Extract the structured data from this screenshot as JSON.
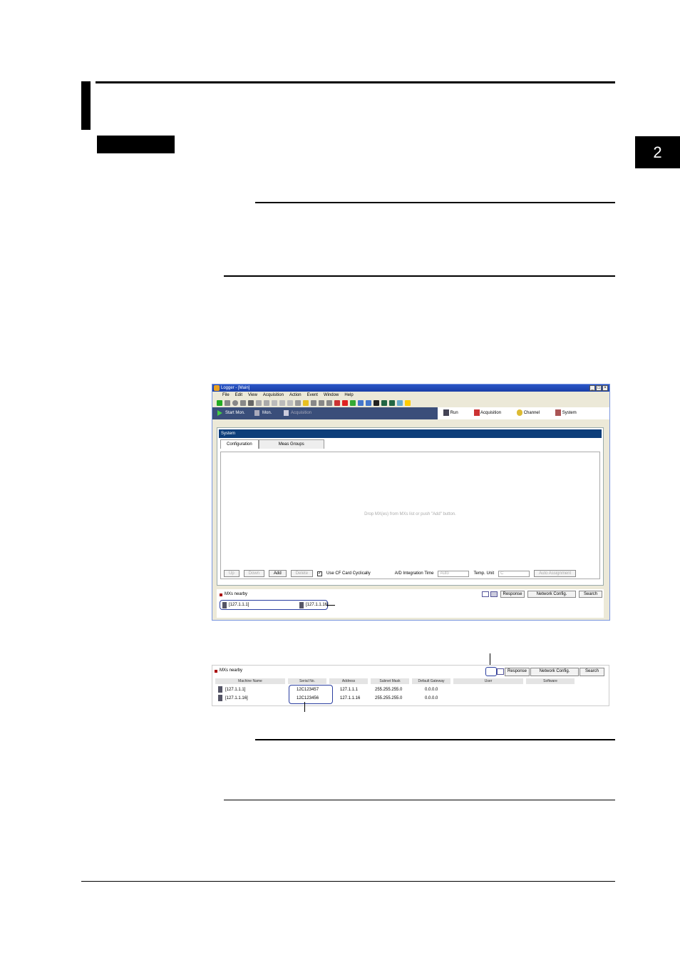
{
  "chapter": {
    "number": "2"
  },
  "screenshot1": {
    "window_title": "Logger - [Main]",
    "menu": [
      "File",
      "Edit",
      "View",
      "Acquisition",
      "Action",
      "Event",
      "Window",
      "Help"
    ],
    "nav_left": [
      "Start Mon.",
      "Mon.",
      "Acquisition"
    ],
    "nav_right": [
      "Run",
      "Acquisition",
      "Channel",
      "System"
    ],
    "panel_title": "System",
    "tabs": [
      "Configuration",
      "Meas Groups"
    ],
    "hint": "Drop MX(es) from MXs list or push \"Add\" button.",
    "buttons": {
      "up": "Up",
      "down": "Down",
      "add": "Add",
      "delete": "Delete"
    },
    "use_cf_label": "Use CF Card Cyclically",
    "ad_label": "A/D Integration Time",
    "ad_value": "Auto",
    "temp_label": "Temp. Unit",
    "temp_value": "C",
    "auto_assign": "Auto Assignment",
    "nearby_label": "MXs nearby",
    "response": "Response",
    "network_config": "Network Config.",
    "search": "Search",
    "devices": [
      "[127.1.1.1]",
      "[127.1.1.16]"
    ]
  },
  "screenshot2": {
    "nearby_label": "MXs nearby",
    "response": "Response",
    "network_config": "Network Config.",
    "search": "Search",
    "columns": [
      "Machine Name",
      "Serial No.",
      "Address",
      "Subnet Mask",
      "Default Gateway",
      "User",
      "Software"
    ],
    "rows": [
      [
        "[127.1.1.1]",
        "12C123457",
        "127.1.1.1",
        "255.255.255.0",
        "0.0.0.0"
      ],
      [
        "[127.1.1.16]",
        "12C123456",
        "127.1.1.16",
        "255.255.255.0",
        "0.0.0.0"
      ]
    ]
  }
}
